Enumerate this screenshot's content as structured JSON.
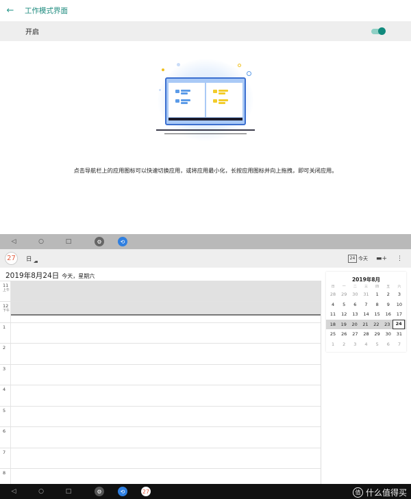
{
  "settings": {
    "title": "工作模式界面",
    "toggle_label": "开启",
    "toggle_on": true,
    "hint": "点击导航栏上的应用图标可以快速切换应用，或将应用最小化，长按应用图标并向上拖拽，即可关闭应用。"
  },
  "colors": {
    "accent": "#118a7d",
    "laptop_frame": "#3b6fcf",
    "pane_left_bars": "#5b9be8",
    "pane_right_bars": "#f2cc2a"
  },
  "nav_icons": [
    "back-triangle",
    "home-circle",
    "recents-square"
  ],
  "calendar": {
    "logo_day": "27",
    "view": "日",
    "today_box": "24",
    "today_label": "今天",
    "date_title": "2019年8月24日",
    "date_sub": "今天，星期六",
    "hours": [
      {
        "n": "11",
        "ampm": "上午"
      },
      {
        "n": "12",
        "ampm": "下午"
      },
      {
        "n": "1",
        "ampm": ""
      },
      {
        "n": "2",
        "ampm": ""
      },
      {
        "n": "3",
        "ampm": ""
      },
      {
        "n": "4",
        "ampm": ""
      },
      {
        "n": "5",
        "ampm": ""
      },
      {
        "n": "6",
        "ampm": ""
      },
      {
        "n": "7",
        "ampm": ""
      },
      {
        "n": "8",
        "ampm": ""
      }
    ],
    "mini": {
      "title": "2019年8月",
      "weekdays": [
        "日",
        "一",
        "二",
        "三",
        "四",
        "五",
        "六"
      ],
      "weeks": [
        [
          "28",
          "29",
          "30",
          "31",
          "1",
          "2",
          "3"
        ],
        [
          "4",
          "5",
          "6",
          "7",
          "8",
          "9",
          "10"
        ],
        [
          "11",
          "12",
          "13",
          "14",
          "15",
          "16",
          "17"
        ],
        [
          "18",
          "19",
          "20",
          "21",
          "22",
          "23",
          "24"
        ],
        [
          "25",
          "26",
          "27",
          "28",
          "29",
          "30",
          "31"
        ],
        [
          "1",
          "2",
          "3",
          "4",
          "5",
          "6",
          "7"
        ]
      ],
      "current_week": 3,
      "selected": "24"
    }
  },
  "bottom_apps": [
    "settings-app",
    "fluent-app",
    "calendar-app"
  ],
  "calendar_app_day": "27",
  "watermark": {
    "badge": "值",
    "text": "什么值得买"
  }
}
